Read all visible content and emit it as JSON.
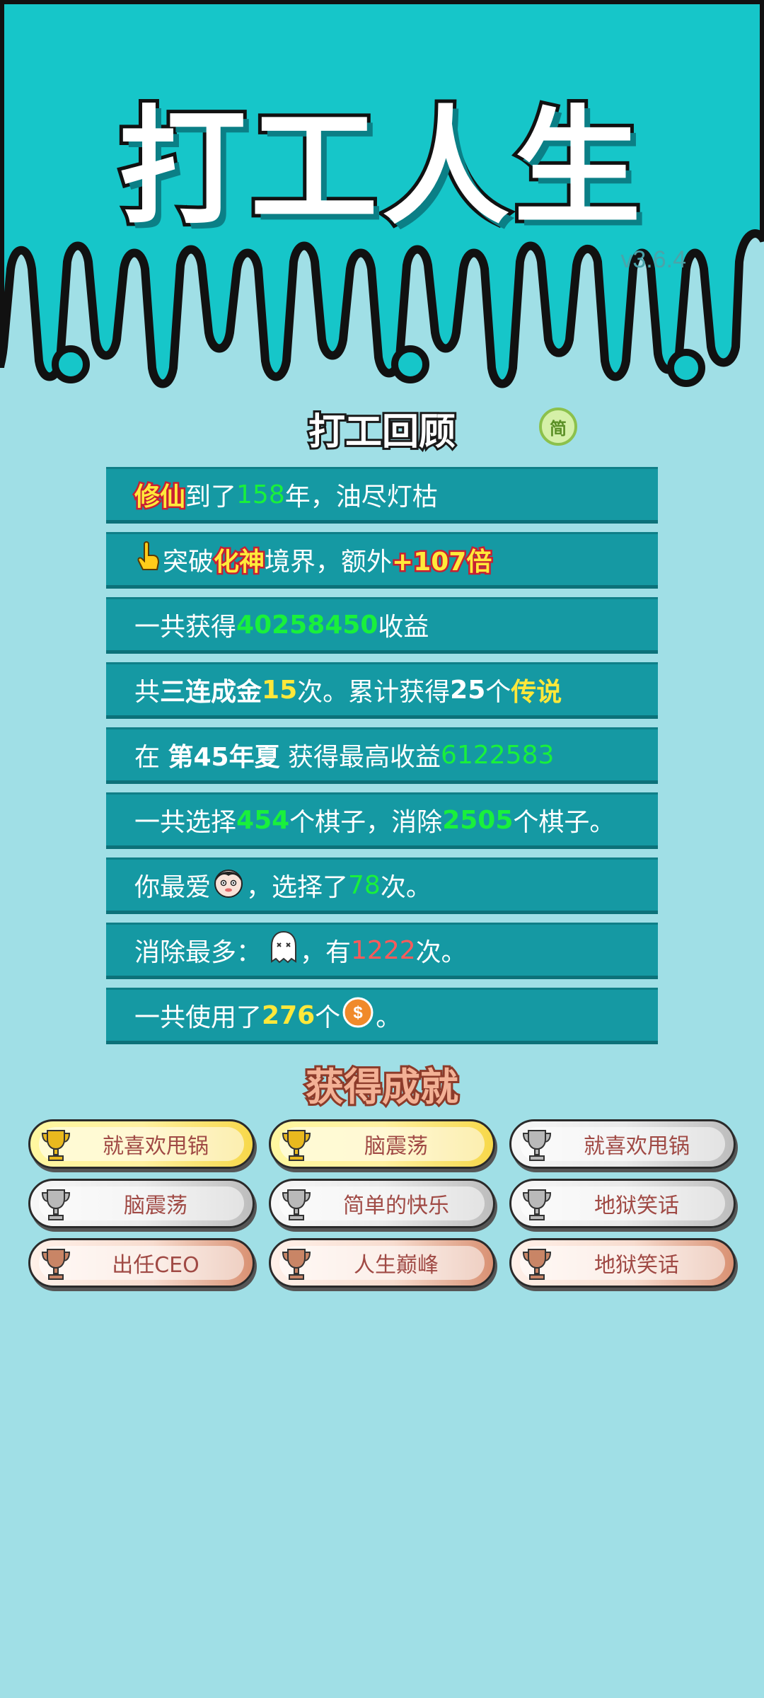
{
  "app": {
    "title": "打工人生",
    "version": "v3.6.4"
  },
  "review": {
    "title": "打工回顾",
    "toggle_label": "简",
    "rows": [
      {
        "parts": [
          "修仙",
          "到了",
          "158",
          "年，油尽灯枯"
        ]
      },
      {
        "parts": [
          "突破",
          "化神",
          "境界，额外",
          "+107倍"
        ]
      },
      {
        "parts": [
          "一共获得",
          "40258450",
          "收益"
        ]
      },
      {
        "parts": [
          "共",
          "三连成金",
          "15",
          "次。累计获得",
          "25",
          "个",
          "传说"
        ]
      },
      {
        "parts": [
          "在",
          "第45年夏",
          "获得最高收益",
          "6122583"
        ]
      },
      {
        "parts": [
          "一共选择",
          "454",
          "个棋子，消除",
          "2505",
          "个棋子。"
        ]
      },
      {
        "parts": [
          "你最爱",
          "，选择了",
          "78",
          "次。"
        ]
      },
      {
        "parts": [
          "消除最多：",
          "，有",
          "1222",
          "次。"
        ]
      },
      {
        "parts": [
          "一共使用了",
          "276",
          "个",
          "。"
        ]
      }
    ]
  },
  "achievements": {
    "title": "获得成就",
    "items": [
      {
        "label": "就喜欢甩锅",
        "tier": "gold"
      },
      {
        "label": "脑震荡",
        "tier": "gold"
      },
      {
        "label": "就喜欢甩锅",
        "tier": "silver"
      },
      {
        "label": "脑震荡",
        "tier": "silver"
      },
      {
        "label": "简单的快乐",
        "tier": "silver"
      },
      {
        "label": "地狱笑话",
        "tier": "silver"
      },
      {
        "label": "出任CEO",
        "tier": "bronze"
      },
      {
        "label": "人生巅峰",
        "tier": "bronze"
      },
      {
        "label": "地狱笑话",
        "tier": "bronze"
      }
    ]
  },
  "colors": {
    "sky": "#16c6c9",
    "background": "#a0dfe6",
    "row_bg": "#1599a3",
    "green_value": "#19f03c",
    "yellow_value": "#ffe83a",
    "red_value": "#ff5a5a"
  }
}
